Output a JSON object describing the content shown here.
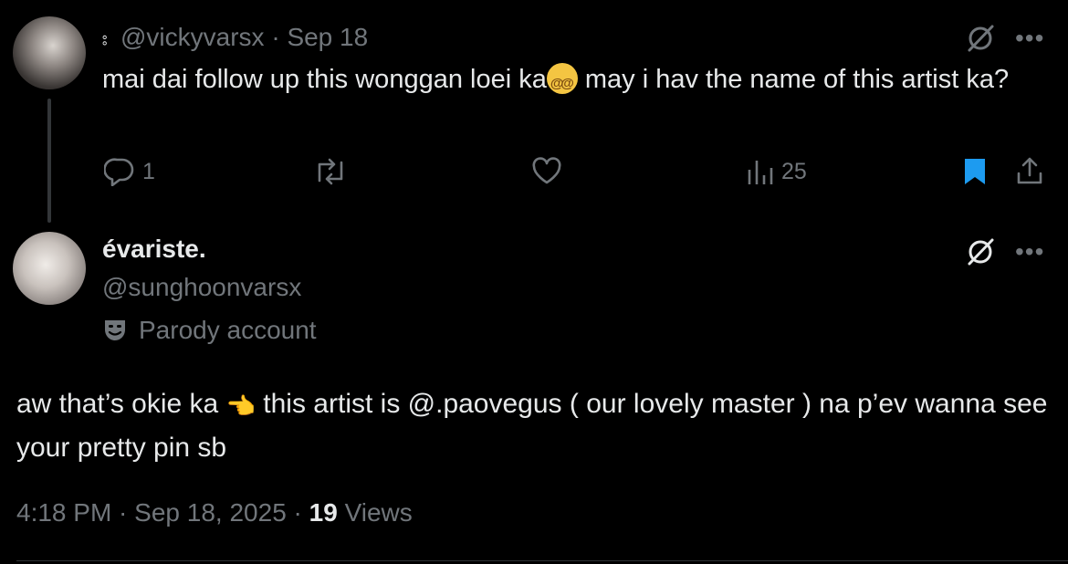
{
  "tweet1": {
    "handle": "@vickyvarsx",
    "separator": "·",
    "date": "Sep 18",
    "text_a": "mai dai follow up this wonggan loei ka",
    "text_b": " may i hav the name of this artist ka?",
    "emoji": "dizzy-face-emoji",
    "reply_count": "1",
    "views_count": "25"
  },
  "tweet2": {
    "display_name": "évariste.",
    "handle": "@sunghoonvarsx",
    "parody_label": "Parody account",
    "text_a": "aw that’s okie ka ",
    "text_b": " this artist is @.paovegus ( our lovely master ) na p’ev wanna see your pretty pin sb",
    "emoji": "backhand-index-pointing-left-emoji",
    "time": "4:18 PM",
    "sep1": " · ",
    "full_date": "Sep 18, 2025",
    "sep2": " · ",
    "views": "19",
    "views_label": " Views"
  },
  "colors": {
    "background": "#000000",
    "text": "#e7e9ea",
    "muted": "#71767b",
    "bookmark_active": "#1d9bf0",
    "divider": "#2f3336"
  }
}
